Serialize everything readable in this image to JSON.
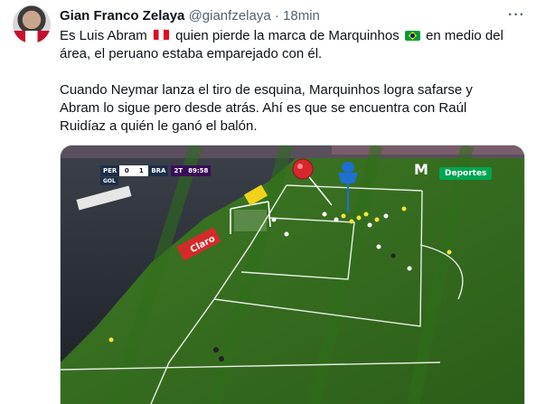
{
  "tweet": {
    "author_name": "Gian Franco Zelaya",
    "handle": "@gianfzelaya",
    "separator": "·",
    "time": "18min",
    "more_icon": "more-icon",
    "line1_part1": "Es Luis Abram",
    "line1_part2": "quien pierde la marca de Marquinhos",
    "line1_part3": "en medio del área, el peruano estaba emparejado con él.",
    "paragraph2": "Cuando Neymar lanza el tiro de esquina, Marquinhos logra safarse y Abram lo sigue pero desde atrás. Ahí es que se encuentra con Raúl Ruidíaz a quién le ganó el balón."
  },
  "video": {
    "scorebug": {
      "home": "PER",
      "home_score": "0",
      "away_score": "1",
      "away": "BRA",
      "period": "2T",
      "clock": "89:58",
      "goal_label": "GOL"
    },
    "channel_logo": "M",
    "channel_label": "Deportes",
    "ad_board_text": "Claro",
    "marker_red_color": "#d7262e",
    "marker_blue_color": "#1f6fd1"
  }
}
